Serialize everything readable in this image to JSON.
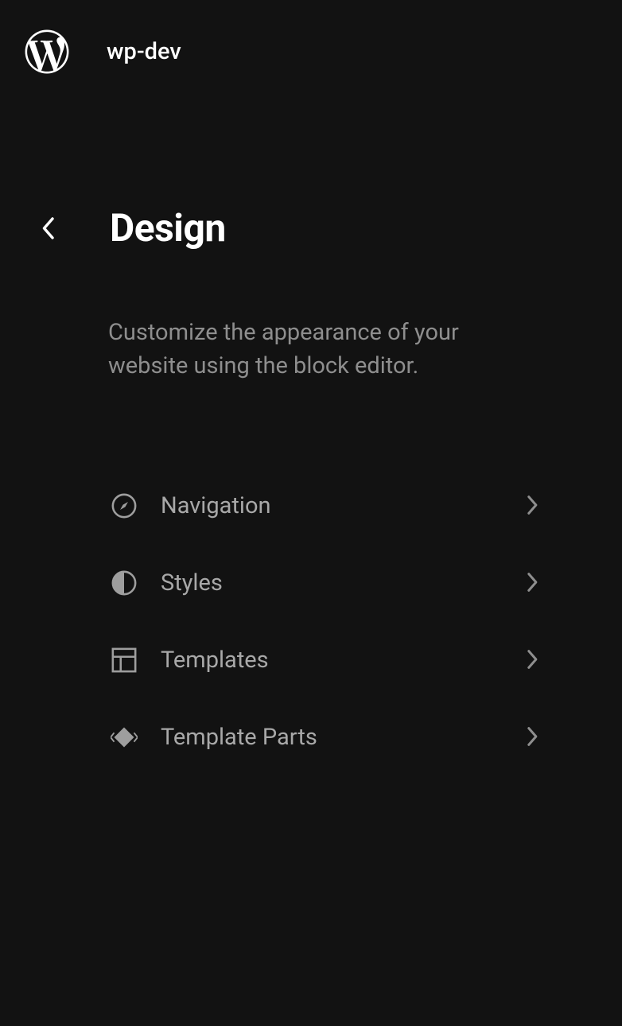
{
  "header": {
    "site_title": "wp-dev"
  },
  "page": {
    "title": "Design",
    "description": "Customize the appearance of your website using the block editor."
  },
  "menu": {
    "items": [
      {
        "label": "Navigation",
        "icon": "compass-icon"
      },
      {
        "label": "Styles",
        "icon": "contrast-icon"
      },
      {
        "label": "Templates",
        "icon": "layout-icon"
      },
      {
        "label": "Template Parts",
        "icon": "diamond-icon"
      }
    ]
  }
}
